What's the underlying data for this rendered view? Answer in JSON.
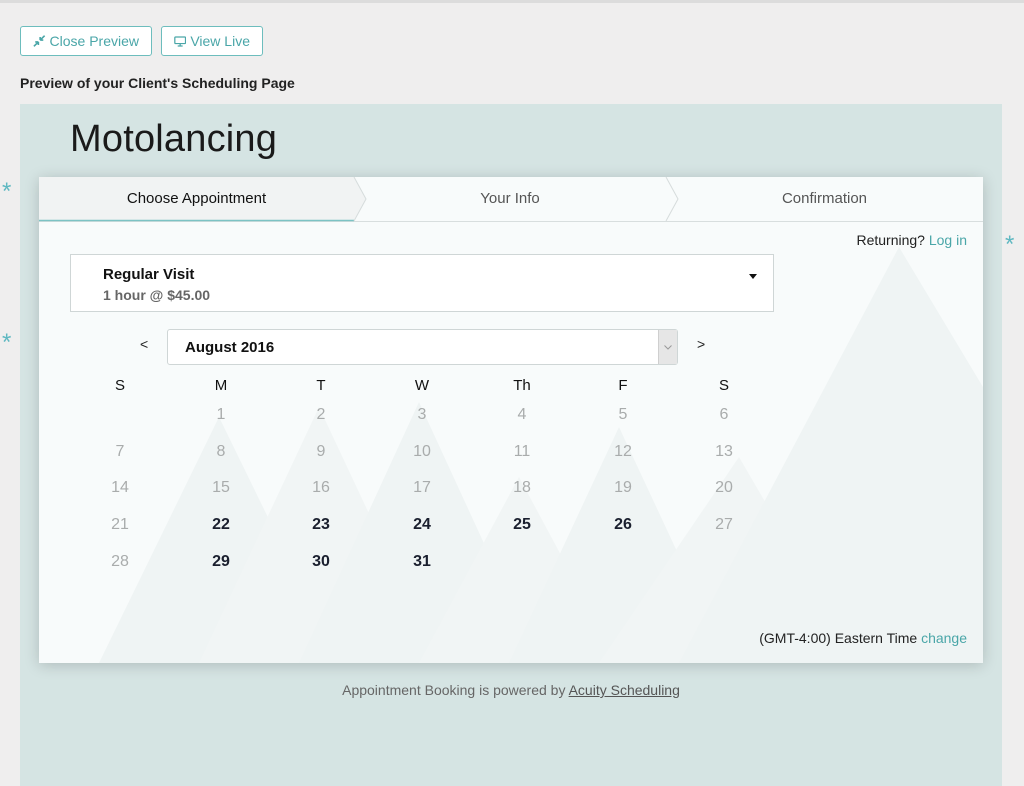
{
  "toolbar": {
    "close_preview_label": "Close Preview",
    "view_live_label": "View Live",
    "preview_label": "Preview of your Client's Scheduling Page"
  },
  "business": {
    "name": "Motolancing"
  },
  "steps": [
    {
      "label": "Choose Appointment",
      "active": true
    },
    {
      "label": "Your Info",
      "active": false
    },
    {
      "label": "Confirmation",
      "active": false
    }
  ],
  "returning": {
    "text": "Returning?",
    "login_label": "Log in"
  },
  "appointment": {
    "name": "Regular Visit",
    "details": "1 hour @ $45.00"
  },
  "calendar": {
    "prev_label": "<",
    "next_label": ">",
    "month": "August 2016",
    "weekdays": [
      "S",
      "M",
      "T",
      "W",
      "Th",
      "F",
      "S"
    ],
    "weeks": [
      [
        null,
        1,
        2,
        3,
        4,
        5,
        6
      ],
      [
        7,
        8,
        9,
        10,
        11,
        12,
        13
      ],
      [
        14,
        15,
        16,
        17,
        18,
        19,
        20
      ],
      [
        21,
        22,
        23,
        24,
        25,
        26,
        27
      ],
      [
        28,
        29,
        30,
        31,
        null,
        null,
        null
      ]
    ],
    "available_days": [
      22,
      23,
      24,
      25,
      26,
      29,
      30,
      31
    ]
  },
  "timezone": {
    "text": "(GMT-4:00) Eastern Time",
    "change_label": "change"
  },
  "footer": {
    "text": "Appointment Booking is powered by",
    "link_label": "Acuity Scheduling"
  },
  "colors": {
    "accent": "#4aa6a8",
    "background": "#d5e4e3",
    "star": "#5fb8c1"
  },
  "decorations": {
    "star_symbol": "*"
  }
}
